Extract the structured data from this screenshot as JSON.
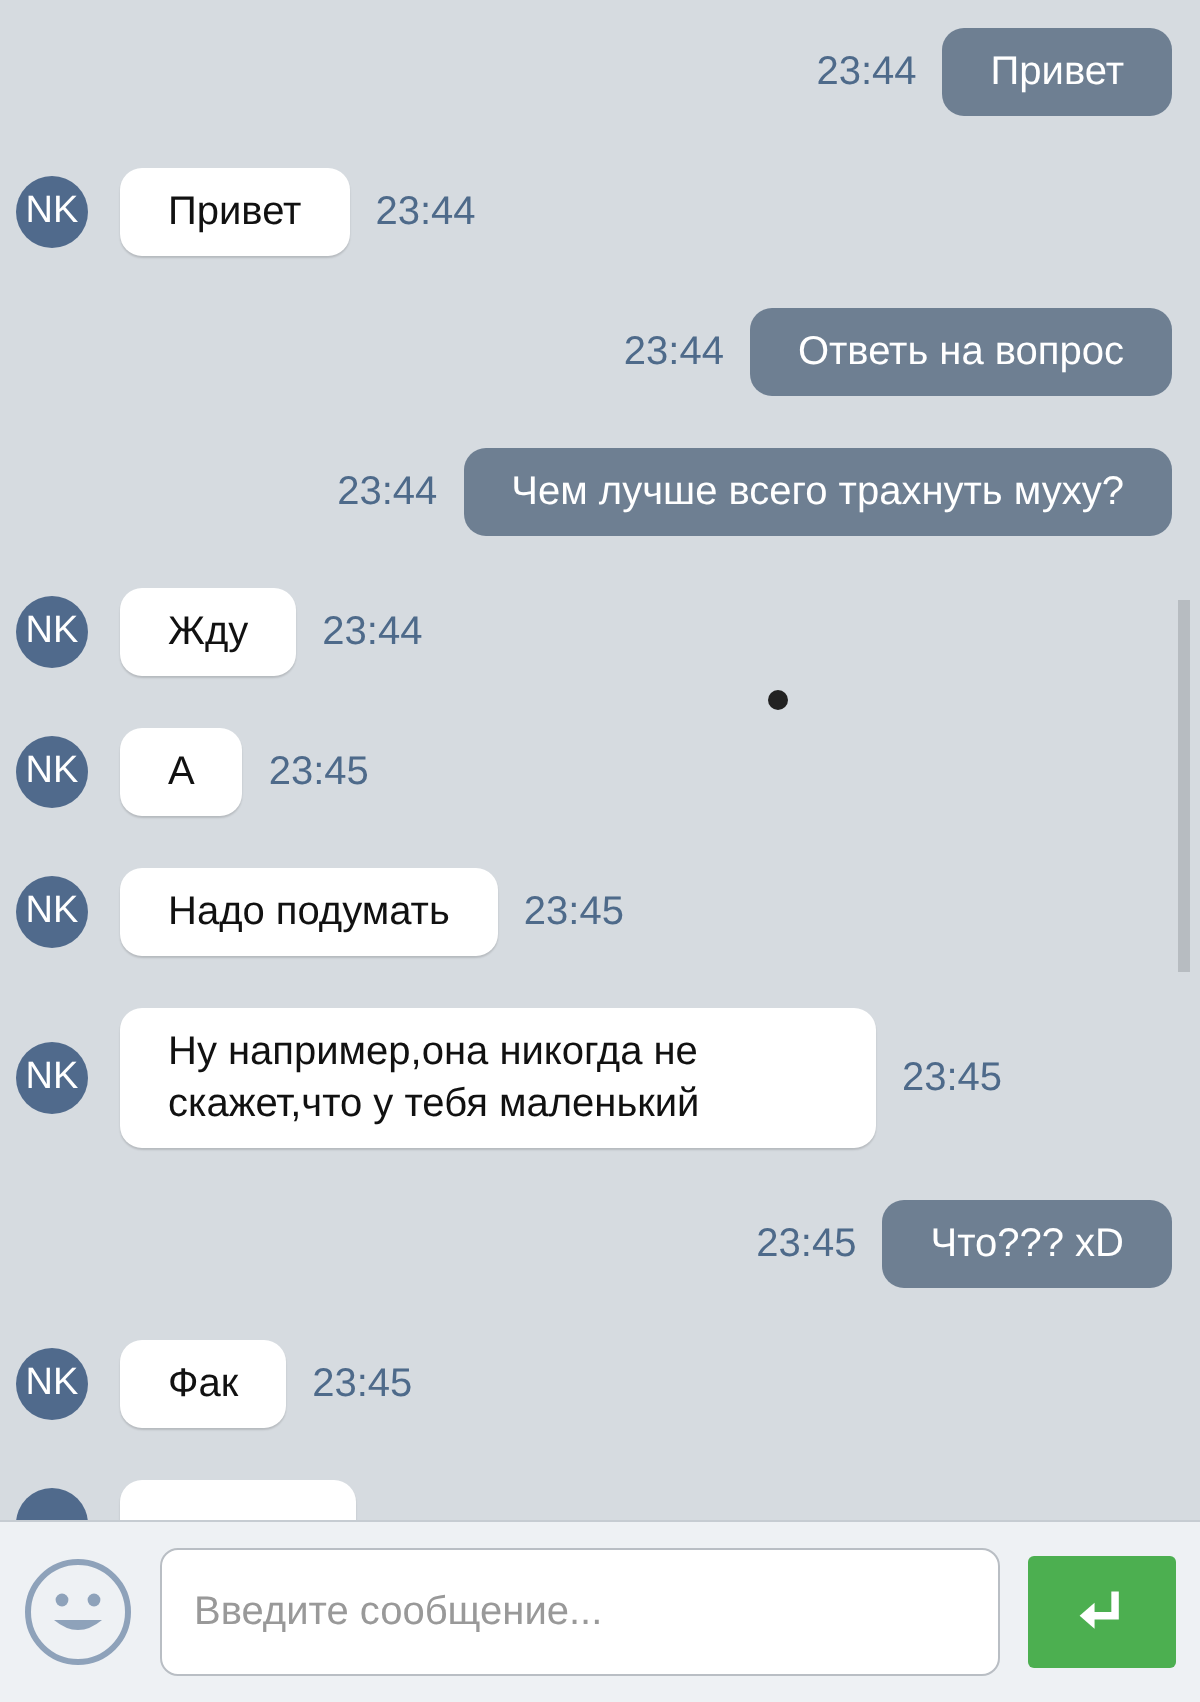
{
  "messages": [
    {
      "kind": "outgoing",
      "text": "Привет",
      "time": "23:44"
    },
    {
      "kind": "incoming",
      "avatar": "NK",
      "text": "Привет",
      "time": "23:44"
    },
    {
      "kind": "outgoing",
      "text": "Ответь на вопрос",
      "time": "23:44"
    },
    {
      "kind": "outgoing",
      "text": "Чем лучше всего трахнуть муху?",
      "time": "23:44"
    },
    {
      "kind": "incoming",
      "avatar": "NK",
      "text": "Жду",
      "time": "23:44"
    },
    {
      "kind": "incoming",
      "avatar": "NK",
      "text": "А",
      "time": "23:45"
    },
    {
      "kind": "incoming",
      "avatar": "NK",
      "text": "Надо подумать",
      "time": "23:45"
    },
    {
      "kind": "incoming",
      "avatar": "NK",
      "text": "Ну например,она никогда не скажет,что у тебя маленький",
      "time": "23:45"
    },
    {
      "kind": "outgoing",
      "text": "Что??? xD",
      "time": "23:45"
    },
    {
      "kind": "incoming",
      "avatar": "NK",
      "text": "Фак",
      "time": "23:45"
    },
    {
      "kind": "incoming",
      "cut": true
    }
  ],
  "composer": {
    "placeholder": "Введите сообщение..."
  }
}
